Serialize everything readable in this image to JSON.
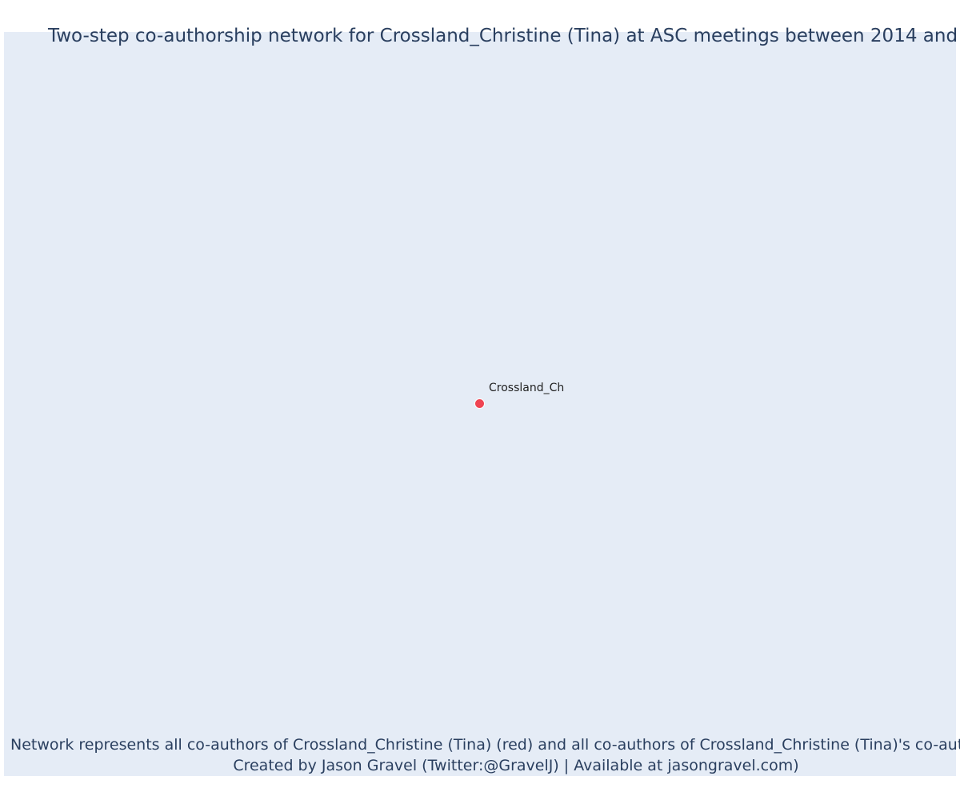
{
  "title": "Two-step co-authorship network for Crossland_Christine (Tina) at ASC meetings between 2014 and",
  "nodes": [
    {
      "label": "Crossland_Ch",
      "color": "#ef4452"
    }
  ],
  "caption": {
    "line1": "Network represents all co-authors of Crossland_Christine (Tina) (red) and all co-authors of Crossland_Christine (Tina)'s co-authors",
    "line2": "Created by Jason Gravel (Twitter:@GravelJ) | Available at jasongravel.com)"
  },
  "colors": {
    "background": "#e5ecf6",
    "text": "#2a3f5f",
    "focal_node": "#ef4452"
  }
}
